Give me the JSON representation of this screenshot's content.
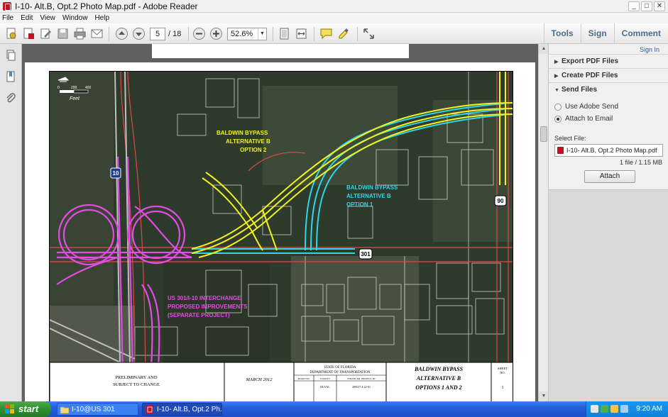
{
  "window": {
    "title": "I-10- Alt.B, Opt.2 Photo Map.pdf - Adobe Reader",
    "buttons": [
      "minimize",
      "maximize",
      "close"
    ]
  },
  "menu": [
    "File",
    "Edit",
    "View",
    "Window",
    "Help"
  ],
  "toolbar": {
    "current_page": "5",
    "total_pages": "/ 18",
    "zoom": "52.6%",
    "tabs": [
      "Tools",
      "Sign",
      "Comment"
    ]
  },
  "icons": {
    "create": "create-pdf-icon",
    "open": "open-icon",
    "edit": "edit-icon",
    "save": "save-icon",
    "print": "print-icon",
    "email": "email-icon",
    "prev": "previous-page-icon",
    "next": "next-page-icon",
    "zoom_out": "zoom-out-icon",
    "zoom_in": "zoom-in-icon",
    "fit_page": "fit-page-icon",
    "fit_width": "fit-width-icon",
    "comment": "comment-icon",
    "highlight": "highlight-icon",
    "fullscreen": "fullscreen-icon",
    "pages": "pages-panel-icon",
    "bookmarks": "bookmarks-icon",
    "attachments": "attachments-icon"
  },
  "right_pane": {
    "sign_in": "Sign In",
    "sections": [
      {
        "label": "Export PDF Files",
        "expanded": false
      },
      {
        "label": "Create PDF Files",
        "expanded": false
      },
      {
        "label": "Send Files",
        "expanded": true
      }
    ],
    "send": {
      "option1": "Use Adobe Send",
      "option2": "Attach to Email",
      "selected": "option2",
      "select_file_label": "Select File:",
      "file_name": "I-10- Alt.B, Opt.2 Photo Map.pdf",
      "file_count": "1 file / 1.15 MB",
      "attach_button": "Attach"
    }
  },
  "map": {
    "scale_label": "Feet",
    "scale_ticks": [
      "0",
      "200",
      "400"
    ],
    "shields": [
      "10",
      "90",
      "301"
    ],
    "labels": {
      "opt2": [
        "BALDWIN BYPASS",
        "ALTERNATIVE B",
        "OPTION 2"
      ],
      "opt1": [
        "BALDWIN BYPASS",
        "ALTERNATIVE B",
        "OPTION 1"
      ],
      "interchange": [
        "US 301/I-10 INTERCHANGE",
        "PROPOSED IMPROVEMENTS",
        "(SEPARATE PROJECT)"
      ]
    },
    "colors": {
      "imagery": "#2f3a2c",
      "option2": "#f4f21c",
      "option1": "#2cd7e8",
      "interchange": "#e34ce3",
      "roads": "#d94a4a"
    },
    "titleblock": {
      "left": [
        "PRELIMINARY AND",
        "SUBJECT TO CHANGE"
      ],
      "date": "MARCH 2012",
      "agency": [
        "STATE OF FLORIDA",
        "DEPARTMENT OF TRANSPORTATION"
      ],
      "headers": [
        "ROAD NO.",
        "COUNTY",
        "FINANCIAL PROJECT ID"
      ],
      "values": [
        "",
        "DUVAL",
        "209537-4-22-01"
      ],
      "project": [
        "BALDWIN BYPASS",
        "ALTERNATIVE B",
        "OPTIONS 1 AND 2"
      ],
      "sheet_label": [
        "SHEET",
        "NO."
      ],
      "sheet_no": "1"
    }
  },
  "taskbar": {
    "start": "start",
    "tasks": [
      "I-10@US 301",
      "I-10- Alt.B, Opt.2 Ph..."
    ],
    "clock": "9:20 AM"
  }
}
